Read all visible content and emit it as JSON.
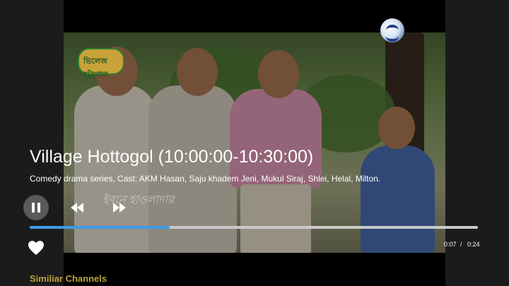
{
  "player": {
    "title": "Village Hottogol  (10:00:00-10:30:00)",
    "description": "Comedy drama series, Cast: AKM Hasan, Saju khadem Jeni, Mukul Siraj, Shlei, Helal, Milton.",
    "controls": {
      "pause_icon": "pause-icon",
      "rewind_icon": "rewind-icon",
      "fast_forward_icon": "fast-forward-icon",
      "favorite_icon": "heart-icon"
    },
    "progress": {
      "fraction": 0.312,
      "accent_color": "#3d9be9",
      "track_color": "#c9c9c9"
    },
    "time": {
      "current": "0:07",
      "separator": "/",
      "duration": "0:24"
    }
  },
  "video_overlay": {
    "show_logo_text": "ভিলেজ হটগোল",
    "episode_text": "ইবনে হাওলাদার"
  },
  "sections": {
    "similar_channels": "Similiar Channels"
  },
  "colors": {
    "section_heading": "#b8a23c"
  }
}
